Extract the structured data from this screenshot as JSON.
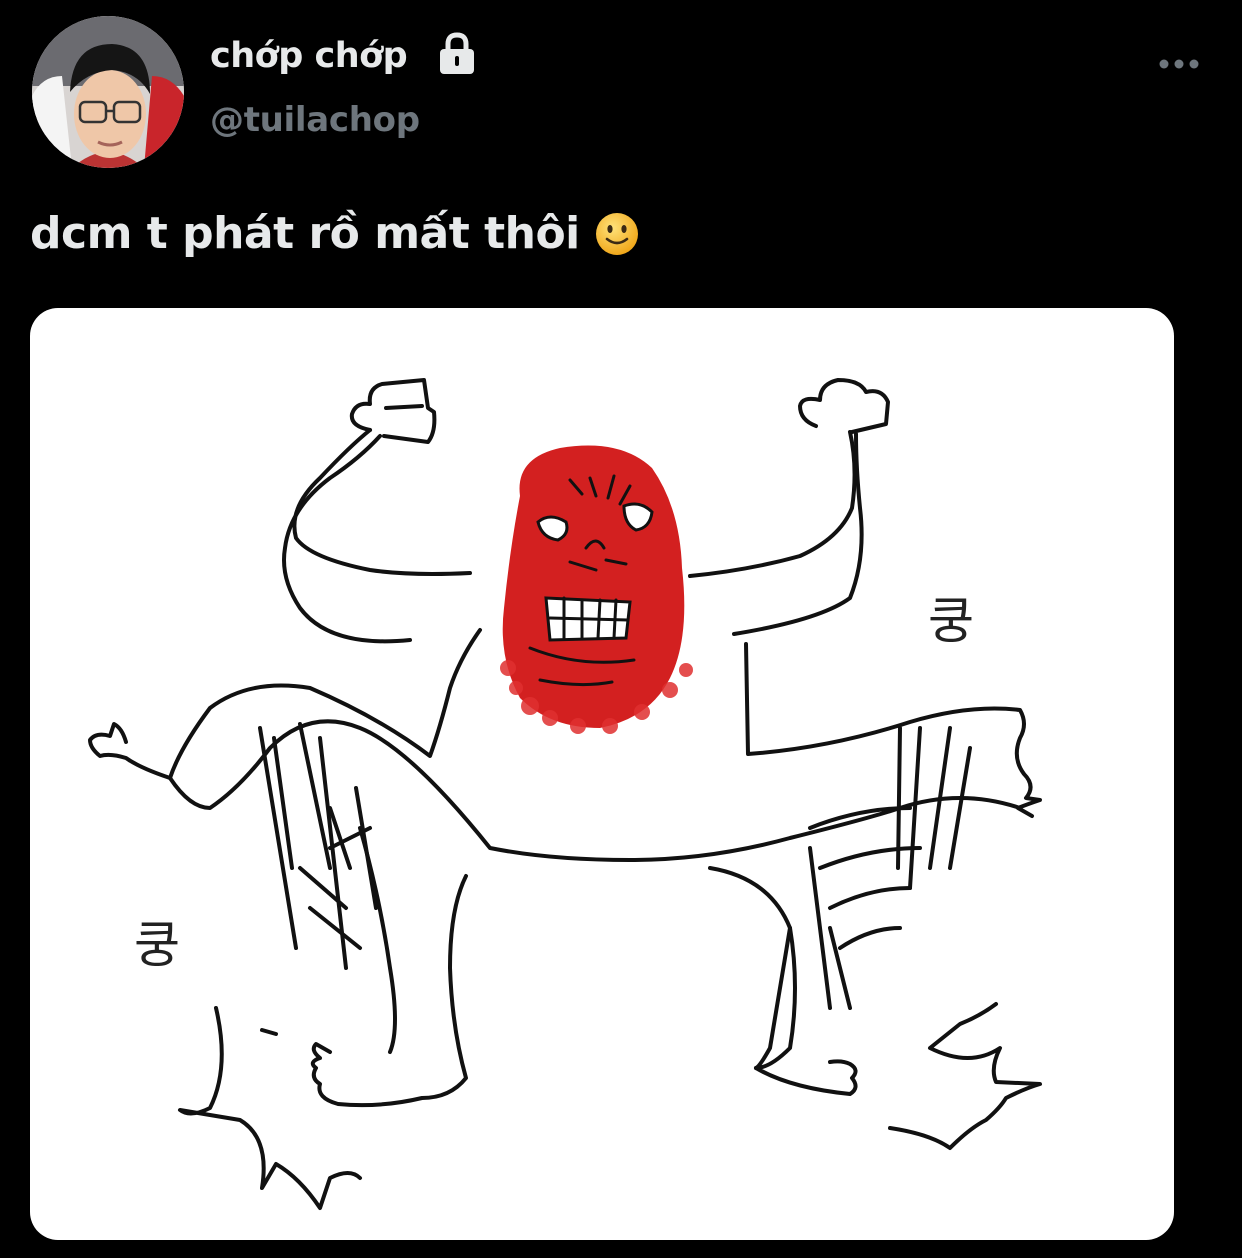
{
  "author": {
    "display_name": "chớp chớp",
    "handle": "@tuilachop",
    "protected": true
  },
  "icons": {
    "lock": "lock-icon",
    "more": "more-horizontal-icon",
    "emoji": "slightly-smiling-face-icon"
  },
  "tweet": {
    "text": "dcm t phát rồ mất thôi"
  },
  "media": {
    "sound_effect_right": "쿵",
    "sound_effect_left": "쿵"
  },
  "colors": {
    "background": "#000000",
    "name": "#e7e9ea",
    "handle": "#6e767d",
    "face": "#d32020"
  }
}
